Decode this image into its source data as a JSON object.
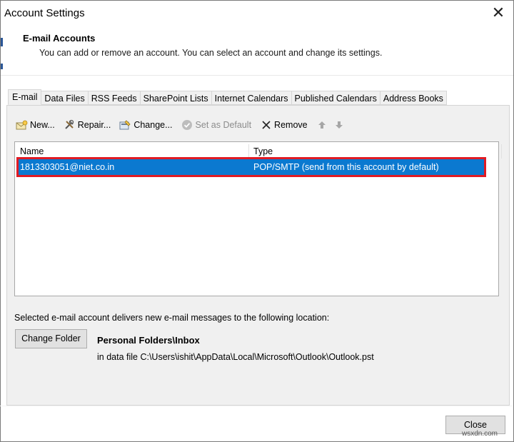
{
  "window": {
    "title": "Account Settings"
  },
  "header": {
    "heading": "E-mail Accounts",
    "description": "You can add or remove an account. You can select an account and change its settings."
  },
  "tabs": [
    {
      "label": "E-mail",
      "active": true
    },
    {
      "label": "Data Files"
    },
    {
      "label": "RSS Feeds"
    },
    {
      "label": "SharePoint Lists"
    },
    {
      "label": "Internet Calendars"
    },
    {
      "label": "Published Calendars"
    },
    {
      "label": "Address Books"
    }
  ],
  "toolbar": {
    "new": "New...",
    "repair": "Repair...",
    "change": "Change...",
    "set_default": "Set as Default",
    "remove": "Remove"
  },
  "accounts_table": {
    "columns": [
      "Name",
      "Type"
    ],
    "rows": [
      {
        "name": "1813303051@niet.co.in",
        "type": "POP/SMTP (send from this account by default)"
      }
    ]
  },
  "delivery": {
    "text": "Selected e-mail account delivers new e-mail messages to the following location:",
    "change_folder_label": "Change Folder",
    "folder_name": "Personal Folders\\Inbox",
    "folder_path": "in data file C:\\Users\\ishit\\AppData\\Local\\Microsoft\\Outlook\\Outlook.pst"
  },
  "footer": {
    "close_label": "Close",
    "watermark": "wsxdn.com"
  },
  "colors": {
    "selection": "#0b79d0",
    "highlight": "#e01b24"
  }
}
